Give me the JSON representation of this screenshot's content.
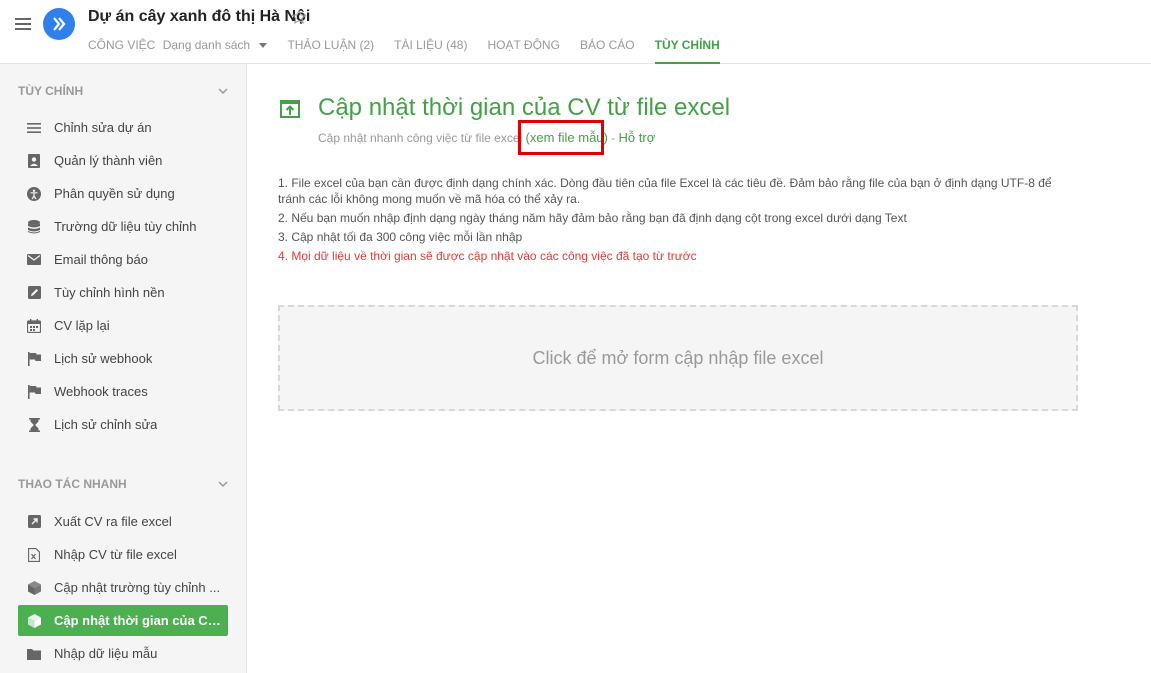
{
  "header": {
    "project_title": "Dự án cây xanh đô thị Hà Nội",
    "nav": [
      {
        "label": "CÔNG VIỆC",
        "sub": "Dạng danh sách"
      },
      {
        "label": "THẢO LUẬN (2)"
      },
      {
        "label": "TÀI LIỆU (48)"
      },
      {
        "label": "HOẠT ĐỘNG"
      },
      {
        "label": "BÁO CÁO"
      },
      {
        "label": "TÙY CHỈNH",
        "active": true
      }
    ]
  },
  "sidebar": {
    "section1_heading": "TÙY CHỈNH",
    "section1_items": [
      {
        "label": "Chỉnh sửa dự án",
        "icon": "menu-icon"
      },
      {
        "label": "Quản lý thành viên",
        "icon": "contact-icon"
      },
      {
        "label": "Phân quyền sử dụng",
        "icon": "accessibility-icon"
      },
      {
        "label": "Trường dữ liệu tùy chỉnh",
        "icon": "database-icon"
      },
      {
        "label": "Email thông báo",
        "icon": "email-icon"
      },
      {
        "label": "Tùy chỉnh hình nền",
        "icon": "edit-icon"
      },
      {
        "label": "CV lặp lại",
        "icon": "calendar-icon"
      },
      {
        "label": "Lịch sử webhook",
        "icon": "flag-icon"
      },
      {
        "label": "Webhook traces",
        "icon": "flag-icon"
      },
      {
        "label": "Lịch sử chỉnh sửa",
        "icon": "hourglass-icon"
      }
    ],
    "section2_heading": "THAO TÁC NHANH",
    "section2_items": [
      {
        "label": "Xuất CV ra file excel",
        "icon": "export-icon"
      },
      {
        "label": "Nhập CV từ file excel",
        "icon": "excel-file-icon"
      },
      {
        "label": "Cập nhật trường tùy chỉnh ...",
        "icon": "cube-icon"
      },
      {
        "label": "Cập nhật thời gian của CV ...",
        "icon": "cube-icon",
        "active": true
      },
      {
        "label": "Nhập dữ liệu mẫu",
        "icon": "folder-icon"
      }
    ]
  },
  "main": {
    "title": "Cập nhật thời gian của CV từ file excel",
    "subtitle_text": "Cập nhật nhanh công việc từ file excel",
    "sample_link": "(xem file mẫu)",
    "separator": " - ",
    "support_link": "Hỗ trợ",
    "instructions": [
      "1. File excel của bạn cần được định dạng chính xác. Dòng đầu tiên của file Excel là các tiêu đề. Đảm bảo rằng file của bạn ở định dạng UTF-8 để tránh các lỗi không mong muốn về mã hóa có thể xảy ra.",
      "2. Nếu bạn muốn nhập định dạng ngày tháng năm hãy đảm bảo rằng bạn đã định dạng cột trong excel dưới dạng Text",
      "3. Cập nhật tối đa 300 công việc mỗi lần nhập",
      "4. Mọi dữ liệu về thời gian sẽ được cập nhật vào các công việc đã tạo từ trước"
    ],
    "dropzone_label": "Click để mở form cập nhập file excel"
  },
  "colors": {
    "accent": "#43a047",
    "active_bg": "#4caf50",
    "warning": "#e53935",
    "highlight": "#e00000",
    "logo": "#2f80ed"
  }
}
